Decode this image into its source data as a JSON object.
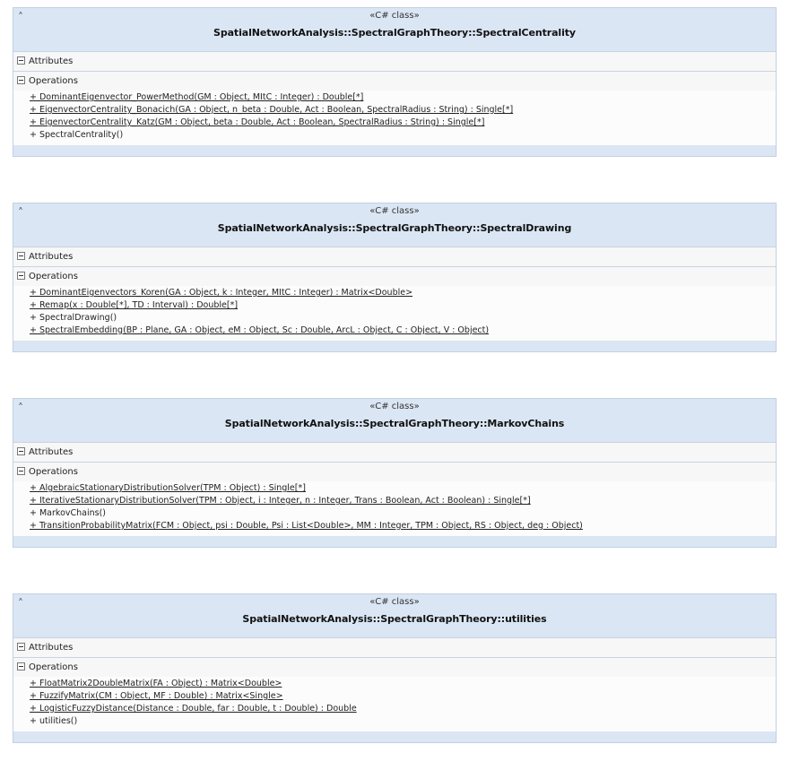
{
  "classes": [
    {
      "stereotype": "«C# class»",
      "name": "SpatialNetworkAnalysis::SpectralGraphTheory::SpectralCentrality",
      "attributes_label": "Attributes",
      "operations_label": "Operations",
      "operations": [
        {
          "text": "+ DominantEigenvector_PowerMethod(GM : Object, MItC : Integer) : Double[*]",
          "static": true
        },
        {
          "text": "+ EigenvectorCentrality_Bonacich(GA : Object, n_beta : Double, Act : Boolean, SpectralRadius : String) : Single[*]",
          "static": true
        },
        {
          "text": "+ EigenvectorCentrality_Katz(GM : Object, beta : Double, Act : Boolean, SpectralRadius : String) : Single[*]",
          "static": true
        },
        {
          "text": "+ SpectralCentrality()",
          "static": false
        }
      ]
    },
    {
      "stereotype": "«C# class»",
      "name": "SpatialNetworkAnalysis::SpectralGraphTheory::SpectralDrawing",
      "attributes_label": "Attributes",
      "operations_label": "Operations",
      "operations": [
        {
          "text": "+ DominantEigenvectors_Koren(GA : Object, k : Integer, MItC : Integer) : Matrix<Double>",
          "static": true
        },
        {
          "text": "+ Remap(x : Double[*], TD : Interval) : Double[*]",
          "static": true
        },
        {
          "text": "+ SpectralDrawing()",
          "static": false
        },
        {
          "text": "+ SpectralEmbedding(BP : Plane, GA : Object, eM : Object, Sc : Double, ArcL : Object, C : Object, V : Object)",
          "static": true
        }
      ]
    },
    {
      "stereotype": "«C# class»",
      "name": "SpatialNetworkAnalysis::SpectralGraphTheory::MarkovChains",
      "attributes_label": "Attributes",
      "operations_label": "Operations",
      "operations": [
        {
          "text": "+ AlgebraicStationaryDistributionSolver(TPM : Object) : Single[*]",
          "static": true
        },
        {
          "text": "+ IterativeStationaryDistributionSolver(TPM : Object, i : Integer, n : Integer, Trans : Boolean, Act : Boolean) : Single[*]",
          "static": true
        },
        {
          "text": "+ MarkovChains()",
          "static": false
        },
        {
          "text": "+ TransitionProbabilityMatrix(FCM : Object, psi : Double, Psi : List<Double>, MM : Integer, TPM : Object, RS : Object, deg : Object)",
          "static": true
        }
      ]
    },
    {
      "stereotype": "«C# class»",
      "name": "SpatialNetworkAnalysis::SpectralGraphTheory::utilities",
      "attributes_label": "Attributes",
      "operations_label": "Operations",
      "operations": [
        {
          "text": "+ FloatMatrix2DoubleMatrix(FA : Object) : Matrix<Double>",
          "static": true
        },
        {
          "text": "+ FuzzifyMatrix(CM : Object, MF : Double) : Matrix<Single>",
          "static": true
        },
        {
          "text": "+ LogisticFuzzyDistance(Distance : Double, far : Double, t : Double) : Double",
          "static": true
        },
        {
          "text": "+ utilities()",
          "static": false
        }
      ]
    }
  ]
}
